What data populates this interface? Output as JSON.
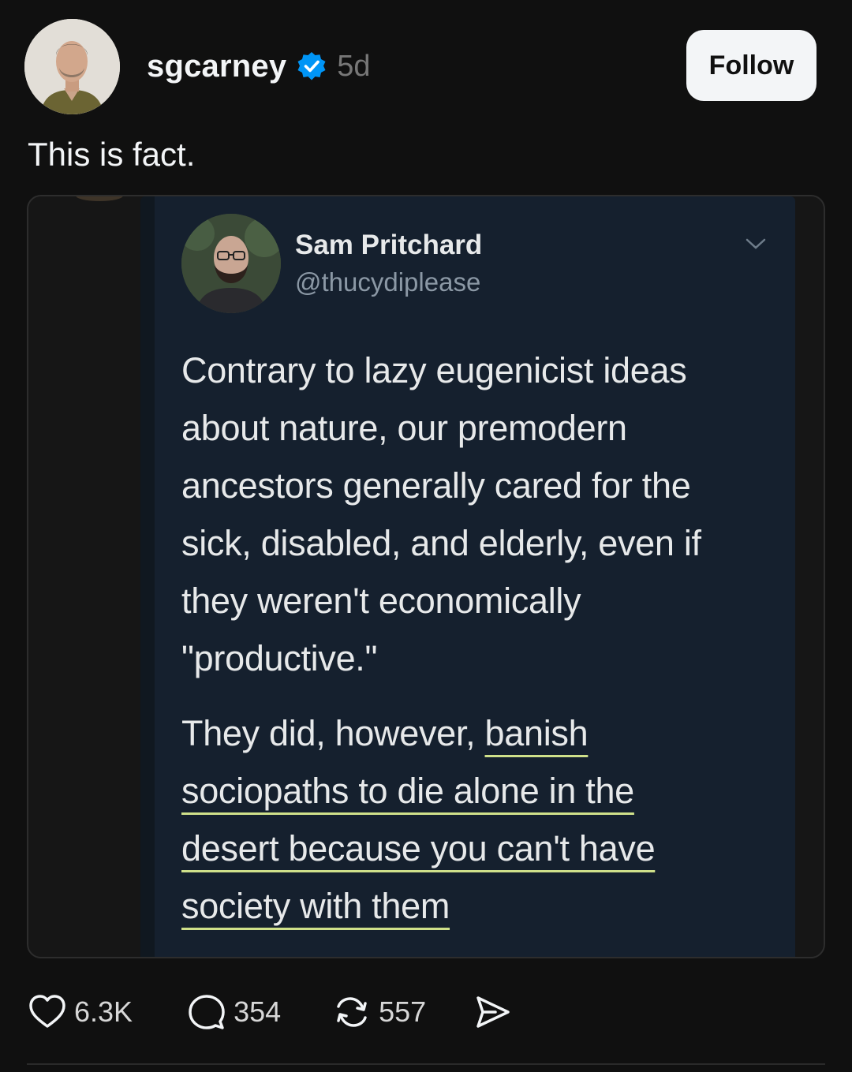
{
  "post": {
    "username": "sgcarney",
    "timestamp": "5d",
    "follow_label": "Follow",
    "caption": "This is fact."
  },
  "tweet": {
    "name": "Sam Pritchard",
    "handle": "@thucydiplease",
    "paragraph1_lines": [
      "Contrary to lazy eugenicist ideas",
      "about nature, our premodern",
      "ancestors generally cared for the",
      "sick, disabled, and elderly, even if",
      "they weren't economically",
      "\"productive.\""
    ],
    "paragraph2": {
      "line1_plain": "They did, however, ",
      "line1_underlined": "banish",
      "line2": "sociopaths to die alone in the",
      "line3": "desert because you can't have",
      "line4": "society with them"
    }
  },
  "actions": {
    "likes": "6.3K",
    "replies": "354",
    "reposts": "557"
  },
  "icons": [
    "verified-badge-icon",
    "chevron-down-icon",
    "heart-icon",
    "comment-icon",
    "repost-icon",
    "share-icon"
  ],
  "colors": {
    "background": "#101010",
    "verified": "#0095f6",
    "tweet_background": "#15202e",
    "highlight_underline": "#cfe08a"
  }
}
